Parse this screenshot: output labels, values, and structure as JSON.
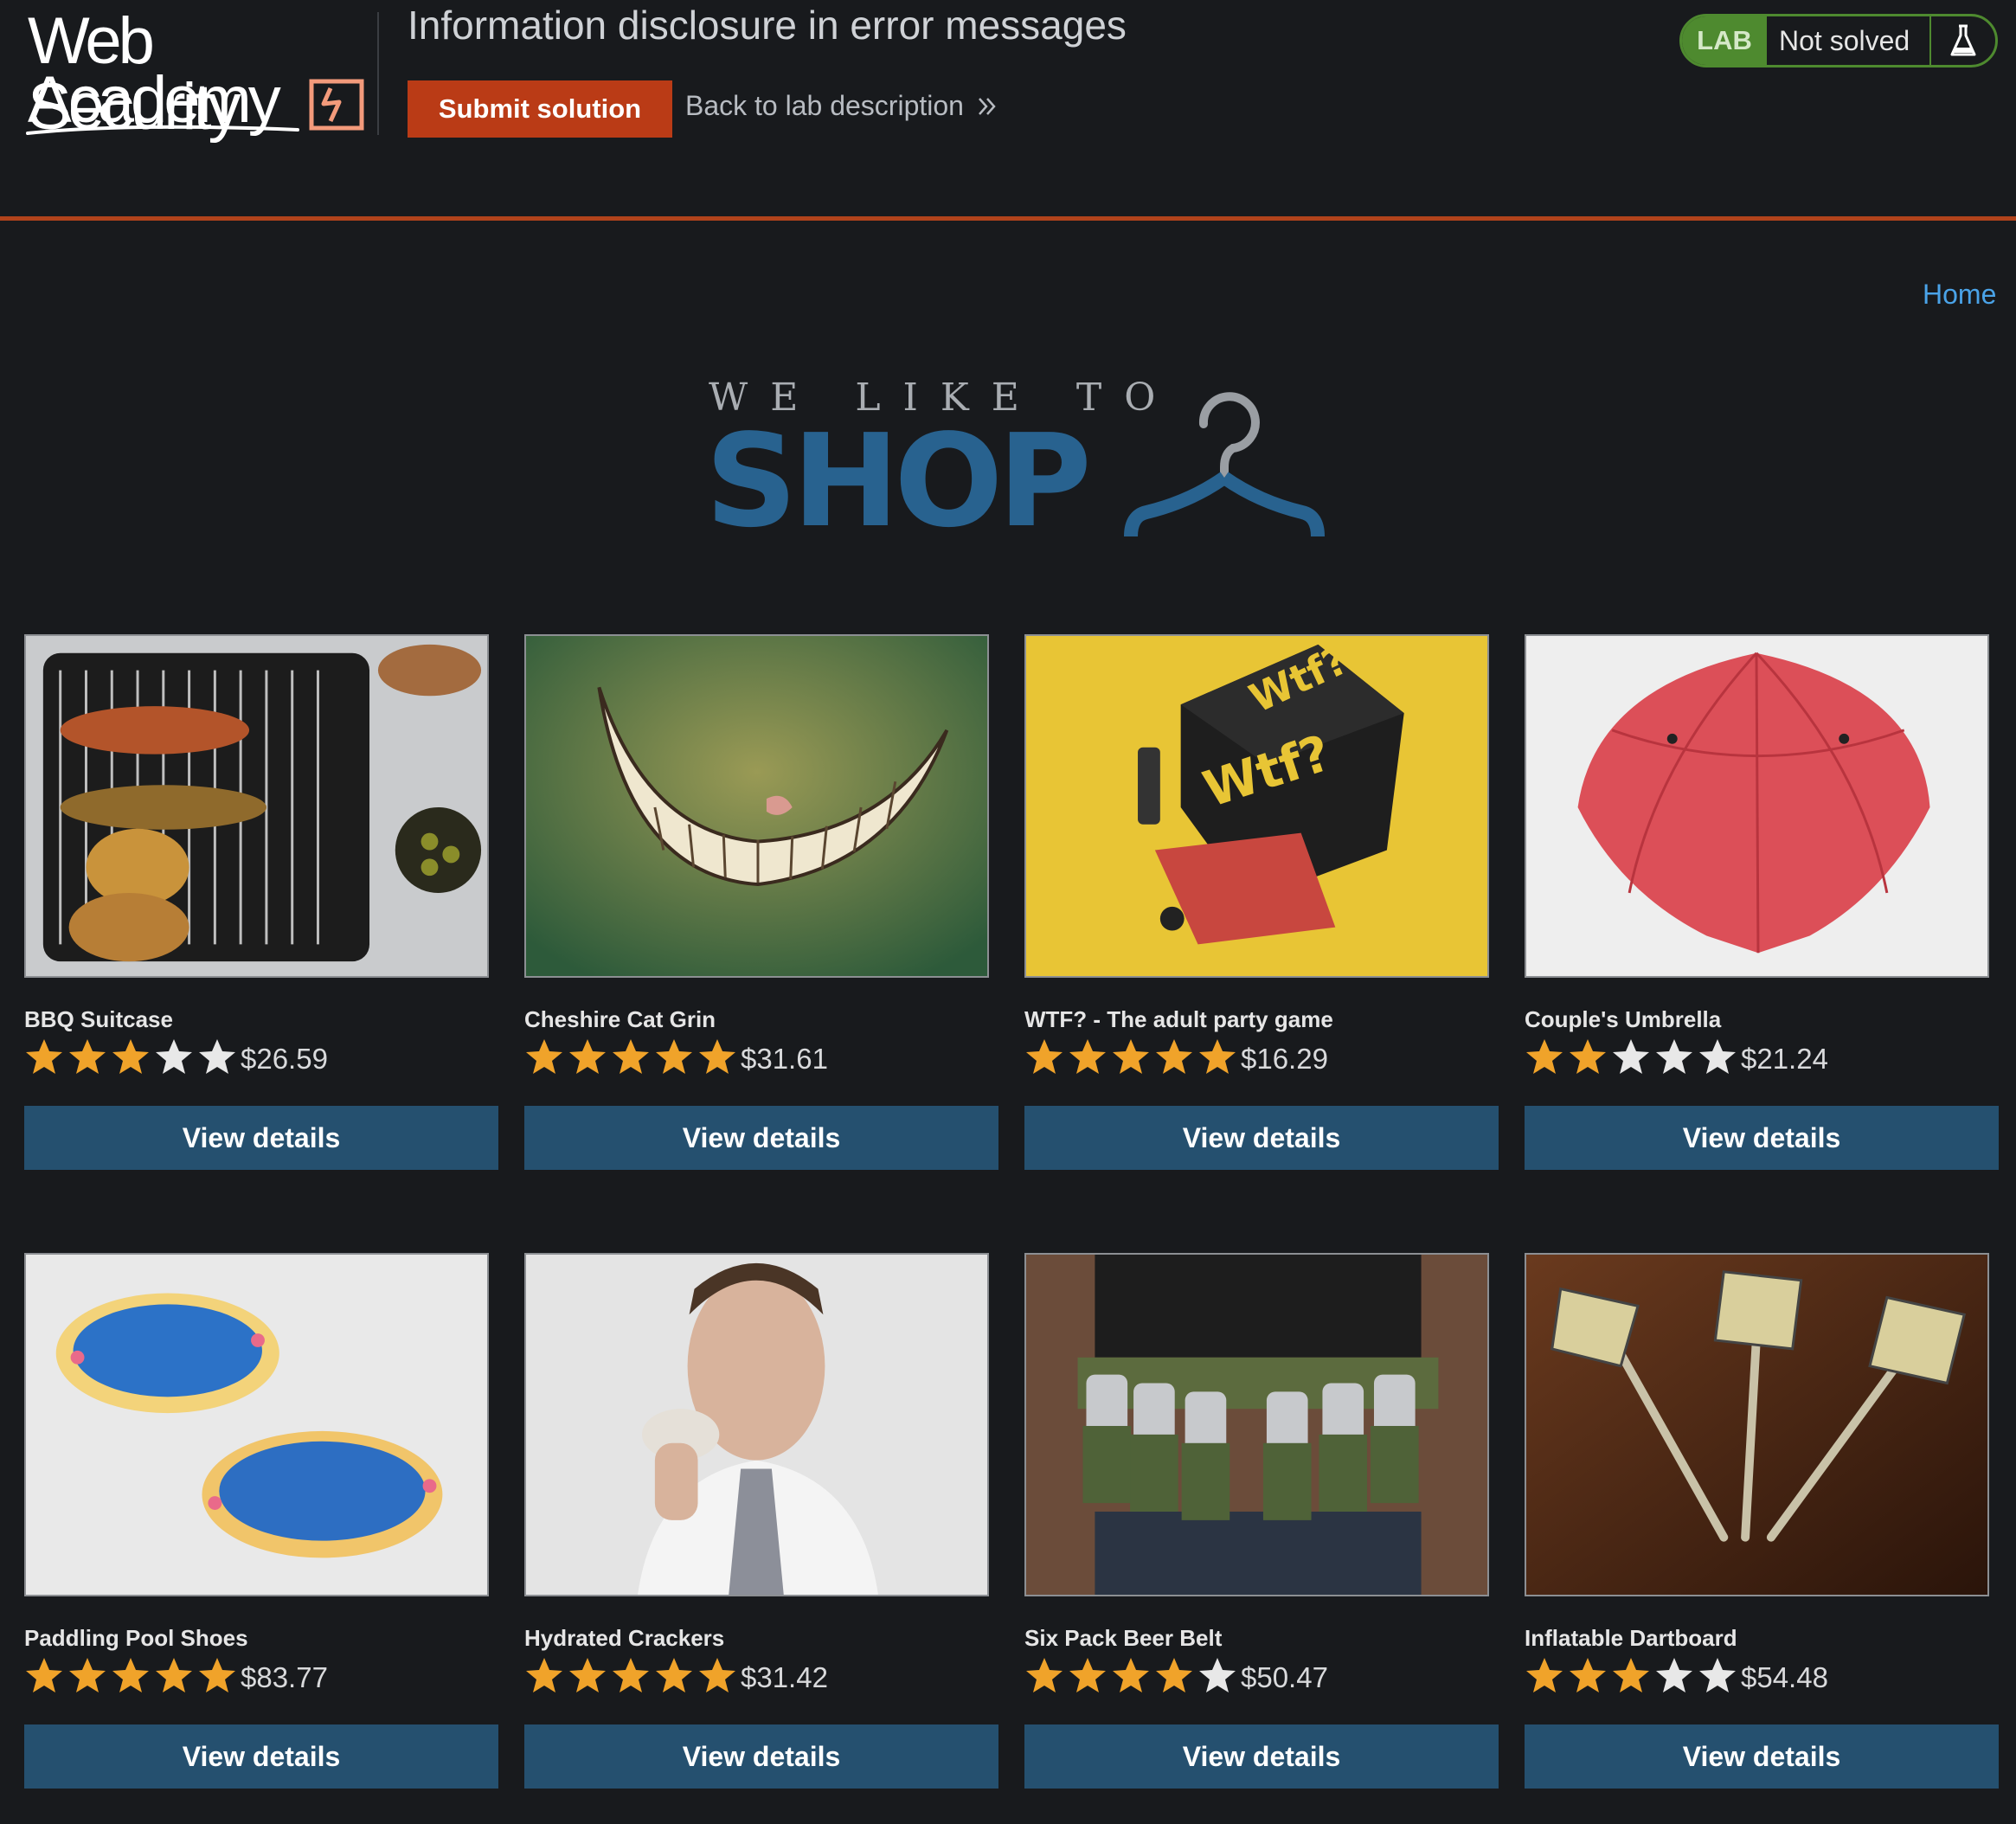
{
  "header": {
    "logo_line1": "Web Security",
    "logo_line2": "Academy",
    "lab_title": "Information disclosure in error messages",
    "submit_label": "Submit solution",
    "back_label": "Back to lab description",
    "lab_badge": "LAB",
    "status": "Not solved",
    "icons": {
      "flask": "flask-icon",
      "chevrons": "double-chevron-right-icon",
      "logo_bolt": "lightning-bolt-icon"
    }
  },
  "nav": {
    "home_label": "Home"
  },
  "banner": {
    "tagline": "WE LIKE TO",
    "shop": "SHOP",
    "icon": "hanger-icon"
  },
  "colors": {
    "background": "#181a1d",
    "accent_orange": "#ba3b16",
    "lab_green": "#4e8a2f",
    "button_blue": "#25506f",
    "link_blue": "#4aa3e8",
    "shop_blue": "#28628f",
    "star_gold": "#f0a32a"
  },
  "products": [
    {
      "name": "BBQ Suitcase",
      "rating": 3,
      "price": "$26.59",
      "button": "View details",
      "image": "bbq-grill-image"
    },
    {
      "name": "Cheshire Cat Grin",
      "rating": 5,
      "price": "$31.61",
      "button": "View details",
      "image": "cat-grin-image"
    },
    {
      "name": "WTF? - The adult party game",
      "rating": 5,
      "price": "$16.29",
      "button": "View details",
      "image": "party-game-box-image"
    },
    {
      "name": "Couple's Umbrella",
      "rating": 2,
      "price": "$21.24",
      "button": "View details",
      "image": "red-umbrella-image"
    },
    {
      "name": "Paddling Pool Shoes",
      "rating": 5,
      "price": "$83.77",
      "button": "View details",
      "image": "paddling-pools-image"
    },
    {
      "name": "Hydrated Crackers",
      "rating": 5,
      "price": "$31.42",
      "button": "View details",
      "image": "man-eating-cracker-image"
    },
    {
      "name": "Six Pack Beer Belt",
      "rating": 4,
      "price": "$50.47",
      "button": "View details",
      "image": "beer-belt-image"
    },
    {
      "name": "Inflatable Dartboard",
      "rating": 3,
      "price": "$54.48",
      "button": "View details",
      "image": "darts-image"
    }
  ]
}
